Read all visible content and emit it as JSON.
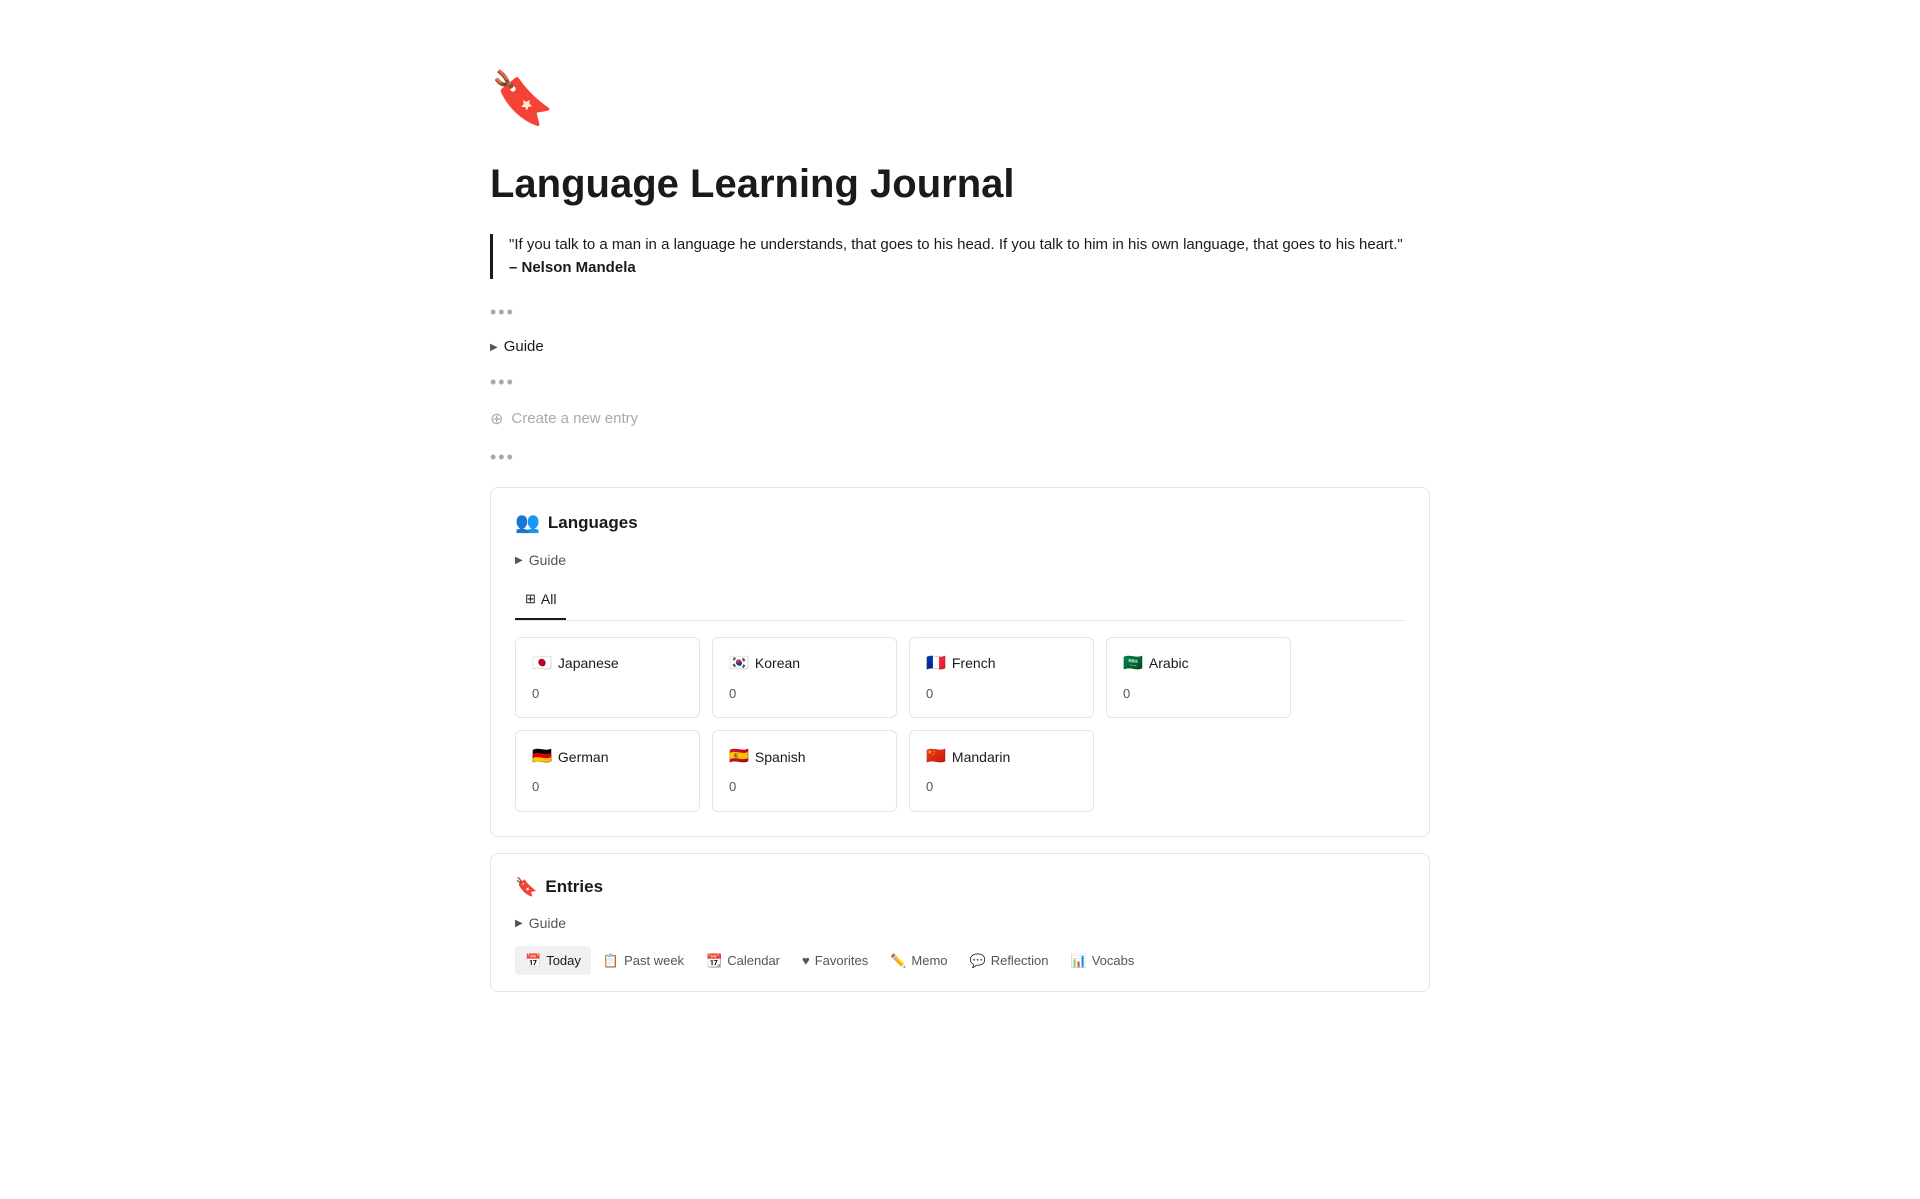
{
  "page": {
    "icon": "🔖",
    "title": "Language Learning Journal",
    "quote_text": "\"If you talk to a man in a language he understands, that goes to his head. If you talk to him in his own language, that goes to his heart.\"",
    "quote_author": "– Nelson Mandela",
    "dots1": "•••",
    "guide_label1": "Guide",
    "dots2": "•••",
    "create_entry_label": "Create a new entry",
    "dots3": "•••"
  },
  "languages_section": {
    "icon": "👥",
    "title": "Languages",
    "guide_label": "Guide",
    "tab_all": "All",
    "cards": [
      {
        "flag": "🇯🇵",
        "name": "Japanese",
        "count": "0"
      },
      {
        "flag": "🇰🇷",
        "name": "Korean",
        "count": "0"
      },
      {
        "flag": "🇫🇷",
        "name": "French",
        "count": "0"
      },
      {
        "flag": "🇸🇦",
        "name": "Arabic",
        "count": "0"
      },
      {
        "flag": "🇩🇪",
        "name": "German",
        "count": "0"
      },
      {
        "flag": "🇪🇸",
        "name": "Spanish",
        "count": "0"
      },
      {
        "flag": "🇨🇳",
        "name": "Mandarin",
        "count": "0"
      }
    ]
  },
  "entries_section": {
    "icon": "🔖",
    "title": "Entries",
    "guide_label": "Guide",
    "tabs": [
      {
        "icon": "📅",
        "label": "Today",
        "active": true
      },
      {
        "icon": "📋",
        "label": "Past week",
        "active": false
      },
      {
        "icon": "📆",
        "label": "Calendar",
        "active": false
      },
      {
        "icon": "♥",
        "label": "Favorites",
        "active": false
      },
      {
        "icon": "✏️",
        "label": "Memo",
        "active": false
      },
      {
        "icon": "💬",
        "label": "Reflection",
        "active": false
      },
      {
        "icon": "📊",
        "label": "Vocabs",
        "active": false
      }
    ]
  }
}
